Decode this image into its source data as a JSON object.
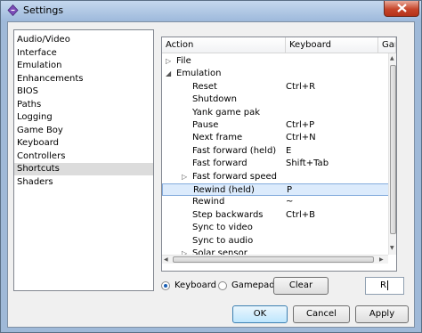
{
  "window": {
    "title": "Settings",
    "close_label": "close"
  },
  "sidebar": {
    "items": [
      {
        "label": "Audio/Video"
      },
      {
        "label": "Interface"
      },
      {
        "label": "Emulation"
      },
      {
        "label": "Enhancements"
      },
      {
        "label": "BIOS"
      },
      {
        "label": "Paths"
      },
      {
        "label": "Logging"
      },
      {
        "label": "Game Boy"
      },
      {
        "label": "Keyboard"
      },
      {
        "label": "Controllers"
      },
      {
        "label": "Shortcuts",
        "selected": true
      },
      {
        "label": "Shaders"
      }
    ]
  },
  "tree": {
    "columns": [
      "Action",
      "Keyboard",
      "Gamepad"
    ],
    "rows": [
      {
        "action": "File",
        "key": "",
        "level": 0,
        "expander": "collapsed"
      },
      {
        "action": "Emulation",
        "key": "",
        "level": 0,
        "expander": "expanded"
      },
      {
        "action": "Reset",
        "key": "Ctrl+R",
        "level": 1
      },
      {
        "action": "Shutdown",
        "key": "",
        "level": 1
      },
      {
        "action": "Yank game pak",
        "key": "",
        "level": 1
      },
      {
        "action": "Pause",
        "key": "Ctrl+P",
        "level": 1
      },
      {
        "action": "Next frame",
        "key": "Ctrl+N",
        "level": 1
      },
      {
        "action": "Fast forward (held)",
        "key": "E",
        "level": 1
      },
      {
        "action": "Fast forward",
        "key": "Shift+Tab",
        "level": 1
      },
      {
        "action": "Fast forward speed",
        "key": "",
        "level": 1,
        "expander": "collapsed"
      },
      {
        "action": "Rewind (held)",
        "key": "P",
        "level": 1,
        "selected": true
      },
      {
        "action": "Rewind",
        "key": "~",
        "level": 1
      },
      {
        "action": "Step backwards",
        "key": "Ctrl+B",
        "level": 1
      },
      {
        "action": "Sync to video",
        "key": "",
        "level": 1
      },
      {
        "action": "Sync to audio",
        "key": "",
        "level": 1
      },
      {
        "action": "Solar sensor",
        "key": "",
        "level": 1,
        "expander": "collapsed"
      }
    ]
  },
  "input_mode": {
    "options": [
      {
        "label": "Keyboard",
        "selected": true
      },
      {
        "label": "Gamepad",
        "selected": false
      }
    ]
  },
  "clear_button": "Clear",
  "key_input": {
    "value": "R"
  },
  "footer": {
    "ok": "OK",
    "cancel": "Cancel",
    "apply": "Apply"
  },
  "colors": {
    "selection": "#dcebfc",
    "selection_border": "#84acdd",
    "accent": "#1a5fb4"
  }
}
